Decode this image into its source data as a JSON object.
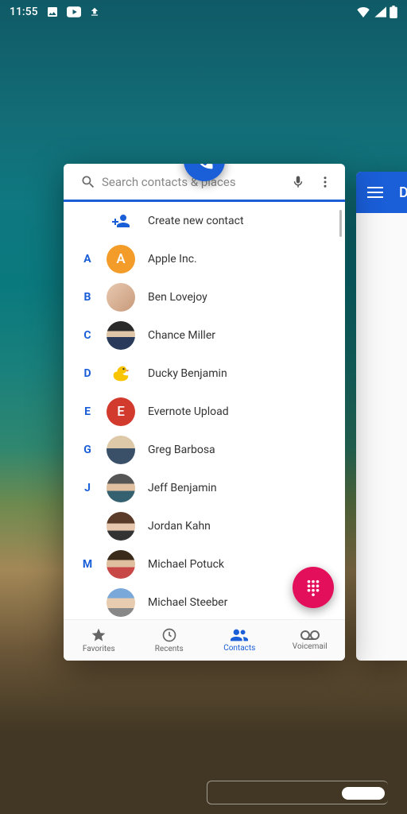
{
  "status": {
    "time": "11:55"
  },
  "search": {
    "placeholder": "Search contacts & places"
  },
  "create_label": "Create new contact",
  "contacts": [
    {
      "letter": "A",
      "name": "Apple Inc.",
      "avatar_class": "av-orange",
      "initial": "A"
    },
    {
      "letter": "B",
      "name": "Ben Lovejoy",
      "avatar_class": "av-photo1",
      "initial": ""
    },
    {
      "letter": "C",
      "name": "Chance Miller",
      "avatar_class": "av-photo2",
      "initial": ""
    },
    {
      "letter": "D",
      "name": "Ducky Benjamin",
      "avatar_class": "av-duck",
      "initial": ""
    },
    {
      "letter": "E",
      "name": "Evernote Upload",
      "avatar_class": "av-red",
      "initial": "E"
    },
    {
      "letter": "G",
      "name": "Greg Barbosa",
      "avatar_class": "av-greg",
      "initial": ""
    },
    {
      "letter": "J",
      "name": "Jeff Benjamin",
      "avatar_class": "av-jeff",
      "initial": ""
    },
    {
      "letter": "",
      "name": "Jordan Kahn",
      "avatar_class": "av-jordan",
      "initial": ""
    },
    {
      "letter": "M",
      "name": "Michael Potuck",
      "avatar_class": "av-mike1",
      "initial": ""
    },
    {
      "letter": "",
      "name": "Michael Steeber",
      "avatar_class": "av-mike2",
      "initial": ""
    }
  ],
  "nav": {
    "favorites": "Favorites",
    "recents": "Recents",
    "contacts": "Contacts",
    "voicemail": "Voicemail",
    "active": "contacts"
  },
  "secondary_app_initial": "D"
}
